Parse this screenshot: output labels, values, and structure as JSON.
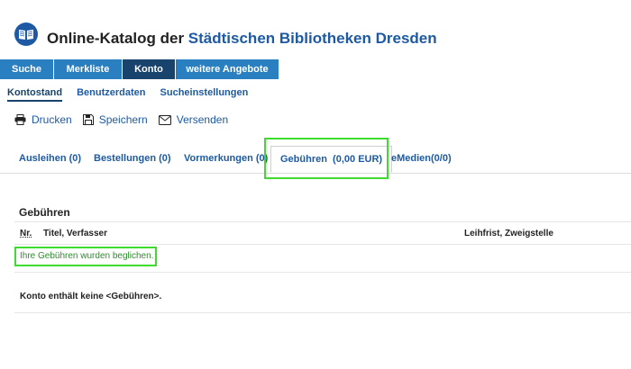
{
  "header": {
    "title_prefix": "Online-Katalog der ",
    "title_accent": "Städtischen Bibliotheken Dresden"
  },
  "main_nav": [
    {
      "label": "Suche"
    },
    {
      "label": "Merkliste"
    },
    {
      "label": "Konto",
      "active": true
    },
    {
      "label": "weitere Angebote"
    }
  ],
  "sub_nav": [
    {
      "label": "Kontostand",
      "active": true
    },
    {
      "label": "Benutzerdaten"
    },
    {
      "label": "Sucheinstellungen"
    }
  ],
  "actions": [
    {
      "label": "Drucken",
      "icon": "printer-icon"
    },
    {
      "label": "Speichern",
      "icon": "floppy-disk-icon"
    },
    {
      "label": "Versenden",
      "icon": "envelope-icon"
    }
  ],
  "account_tabs": [
    {
      "label": "Ausleihen (0)"
    },
    {
      "label": "Bestellungen (0)"
    },
    {
      "label": "Vormerkungen (0)"
    },
    {
      "label": "Gebühren  (0,00 EUR)",
      "active": true
    },
    {
      "label": "eMedien(0/0)"
    }
  ],
  "fees": {
    "section_title": "Gebühren",
    "columns": {
      "nr": "Nr.",
      "title_author": "Titel, Verfasser",
      "due_branch": "Leihfrist, Zweigstelle"
    },
    "notice": "Ihre Gebühren wurden beglichen.",
    "empty_message": "Konto enthält keine <Gebühren>."
  },
  "colors": {
    "brand": "#1d5aa3",
    "nav": "#2a7fc0",
    "nav_active": "#17436d",
    "highlight": "#3ddc2e",
    "notice_text": "#2e8b2e"
  }
}
